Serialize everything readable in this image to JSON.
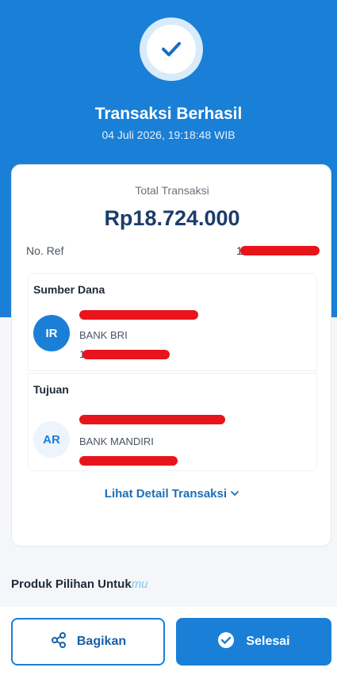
{
  "header": {
    "title": "Transaksi Berhasil",
    "datetime": "04 Juli 2026, 19:18:48 WIB",
    "icon": "check-circle-icon"
  },
  "summary": {
    "total_label": "Total Transaksi",
    "total_value": "Rp18.724.000",
    "ref_label": "No. Ref",
    "ref_value": "1"
  },
  "source": {
    "heading": "Sumber Dana",
    "initials": "IR",
    "bank": "BANK BRI",
    "account_prefix": "1"
  },
  "destination": {
    "heading": "Tujuan",
    "initials": "AR",
    "bank": "BANK MANDIRI"
  },
  "detail_link": "Lihat Detail Transaksi",
  "promo": {
    "title": "Produk Pilihan Untuk",
    "title_suffix": "mu"
  },
  "actions": {
    "share_label": "Bagikan",
    "done_label": "Selesai"
  },
  "colors": {
    "primary": "#1a7fd6",
    "redaction": "#e8141b"
  }
}
